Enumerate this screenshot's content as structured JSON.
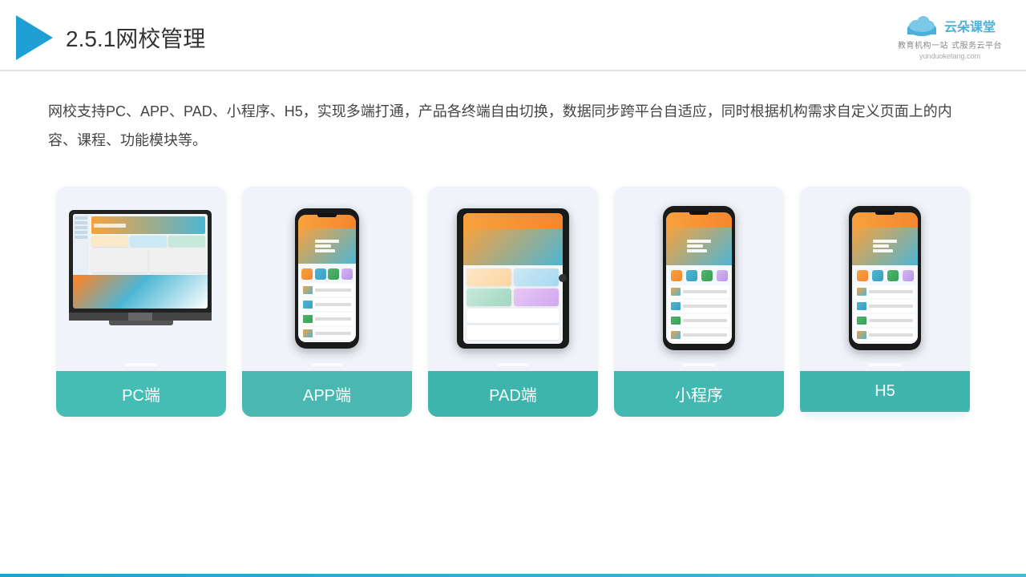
{
  "header": {
    "title_prefix": "2.5.1",
    "title_main": "网校管理"
  },
  "logo": {
    "brand": "云朵课堂",
    "url": "yunduoketang.com",
    "tagline": "教育机构一站",
    "tagline2": "式服务云平台"
  },
  "description": {
    "text": "网校支持PC、APP、PAD、小程序、H5，实现多端打通，产品各终端自由切换，数据同步跨平台自适应，同时根据机构需求自定义页面上的内容、课程、功能模块等。"
  },
  "cards": [
    {
      "id": "pc",
      "label": "PC端"
    },
    {
      "id": "app",
      "label": "APP端"
    },
    {
      "id": "pad",
      "label": "PAD端"
    },
    {
      "id": "miniprogram",
      "label": "小程序"
    },
    {
      "id": "h5",
      "label": "H5"
    }
  ],
  "colors": {
    "accent": "#1fa0d5",
    "teal": "#45bdb5",
    "header_line": "#e0e0e0"
  }
}
